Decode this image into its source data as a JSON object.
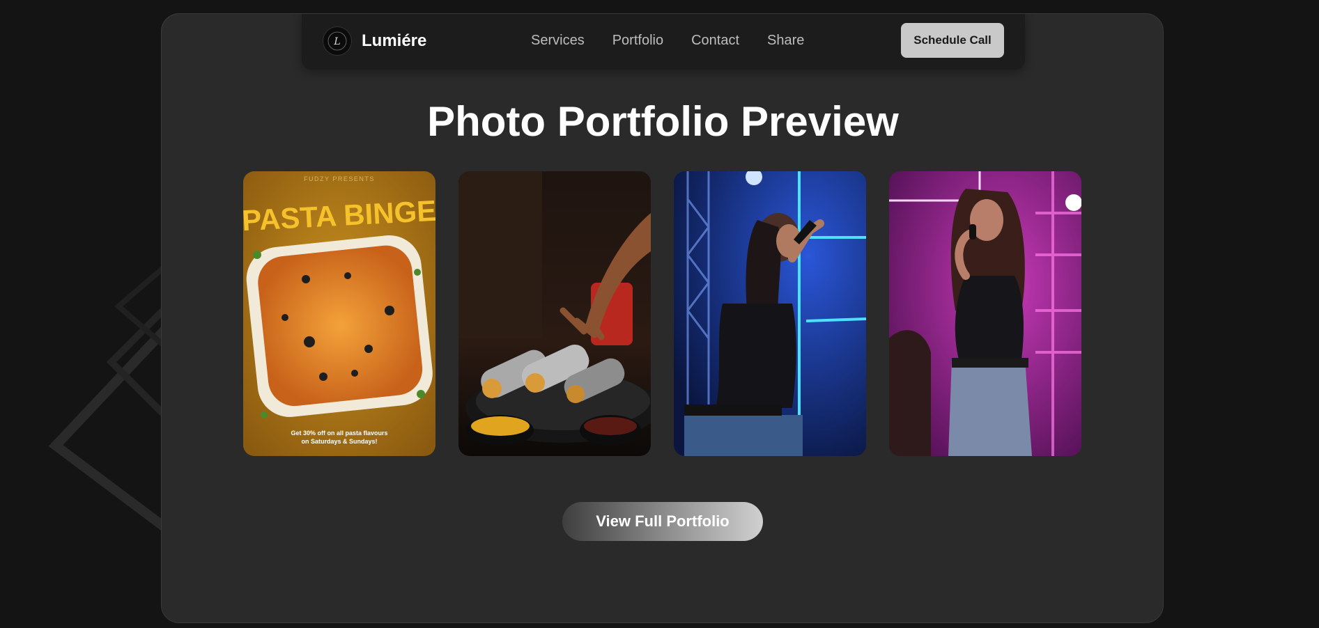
{
  "brand": {
    "name": "Lumiére",
    "logo_letter": "L"
  },
  "nav": {
    "links": [
      "Services",
      "Portfolio",
      "Contact",
      "Share"
    ],
    "cta_label": "Schedule Call"
  },
  "main": {
    "title": "Photo Portfolio Preview",
    "view_button_label": "View Full Portfolio"
  },
  "gallery": {
    "items": [
      {
        "presenter": "FUDZY PRESENTS",
        "headline": "PASTA BINGE",
        "offer_line1": "Get 30% off on all pasta flavours",
        "offer_line2": "on Saturdays & Sundays!",
        "icon": "pasta-photo"
      },
      {
        "icon": "food-rolls-photo"
      },
      {
        "icon": "singer-blue-stage-photo"
      },
      {
        "icon": "singer-pink-stage-photo"
      }
    ]
  },
  "colors": {
    "page_bg": "#141414",
    "panel_bg": "#2a2a2a",
    "nav_bg": "#1c1c1c",
    "cta_bg": "#c9c9c9",
    "text_primary": "#ffffff",
    "text_muted": "#bdbdbd"
  }
}
